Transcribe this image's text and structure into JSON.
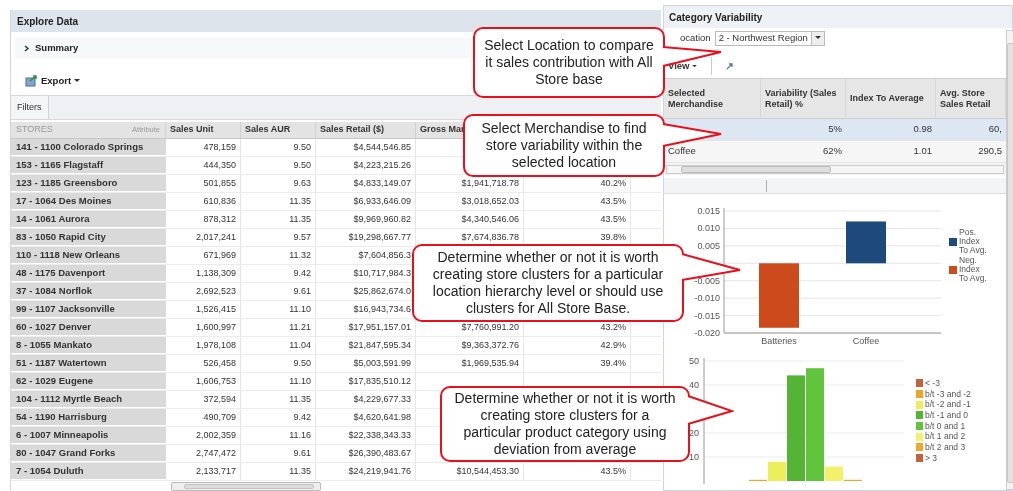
{
  "explore_panel": {
    "title": "Explore Data",
    "summary": {
      "label": "Summary",
      "expanded": false
    },
    "export_label": "Export",
    "filters_tab": "Filters",
    "table": {
      "columns": {
        "store": "STORES",
        "attribute": "Attribute",
        "sales_unit": "Sales Unit",
        "sales_aur": "Sales AUR",
        "sales_retail": "Sales Retail ($)",
        "gross_margin": "Gross Mar"
      },
      "rows": [
        {
          "store": "141 - 1100 Colorado Springs",
          "sales_unit": "478,159",
          "sales_aur": "9.50",
          "sales_retail": "$4,544,546.85"
        },
        {
          "store": "153 - 1165 Flagstaff",
          "sales_unit": "444,350",
          "sales_aur": "9.50",
          "sales_retail": "$4,223,215.26"
        },
        {
          "store": "123 - 1185 Greensboro",
          "sales_unit": "501,855",
          "sales_aur": "9.63",
          "sales_retail": "$4,833,149.07",
          "gross_margin": "$1,941,718.78",
          "column_6": "40.2%"
        },
        {
          "store": "17 - 1064 Des Moines",
          "sales_unit": "610,836",
          "sales_aur": "11.35",
          "sales_retail": "$6,933,646.09",
          "gross_margin": "$3,018,652.03",
          "column_6": "43.5%"
        },
        {
          "store": "14 - 1061 Aurora",
          "sales_unit": "878,312",
          "sales_aur": "11.35",
          "sales_retail": "$9,969,960.82",
          "gross_margin": "$4,340,546.06",
          "column_6": "43.5%"
        },
        {
          "store": "83 - 1050 Rapid City",
          "sales_unit": "2,017,241",
          "sales_aur": "9.57",
          "sales_retail": "$19,298,667.77",
          "gross_margin": "$7,674,836.78",
          "column_6": "39.8%"
        },
        {
          "store": "110 - 1118 New Orleans",
          "sales_unit": "671,969",
          "sales_aur": "11.32",
          "sales_retail": "$7,604,856.3"
        },
        {
          "store": "48 - 1175 Davenport",
          "sales_unit": "1,138,309",
          "sales_aur": "9.42",
          "sales_retail": "$10,717,984.3"
        },
        {
          "store": "37 - 1084 Norflok",
          "sales_unit": "2,692,523",
          "sales_aur": "9.61",
          "sales_retail": "$25,862,674.0"
        },
        {
          "store": "99 - 1107 Jacksonville",
          "sales_unit": "1,526,415",
          "sales_aur": "11.10",
          "sales_retail": "$16,943,734.6"
        },
        {
          "store": "60 - 1027 Denver",
          "sales_unit": "1,600,997",
          "sales_aur": "11.21",
          "sales_retail": "$17,951,157.01",
          "gross_margin": "$7,760,991.20",
          "column_6": "43.2%"
        },
        {
          "store": "8 - 1055 Mankato",
          "sales_unit": "1,978,108",
          "sales_aur": "11.04",
          "sales_retail": "$21,847,595.34",
          "gross_margin": "$9,363,372.76",
          "column_6": "42.9%"
        },
        {
          "store": "51 - 1187 Watertown",
          "sales_unit": "526,458",
          "sales_aur": "9.50",
          "sales_retail": "$5,003,591.99",
          "gross_margin": "$1,969,535.94",
          "column_6": "39.4%"
        },
        {
          "store": "62 - 1029 Eugene",
          "sales_unit": "1,606,753",
          "sales_aur": "11.10",
          "sales_retail": "$17,835,510.12"
        },
        {
          "store": "104 - 1112 Myrtle Beach",
          "sales_unit": "372,594",
          "sales_aur": "11.35",
          "sales_retail": "$4,229,677.33"
        },
        {
          "store": "54 - 1190 Harrisburg",
          "sales_unit": "490,709",
          "sales_aur": "9.42",
          "sales_retail": "$4,620,641.98"
        },
        {
          "store": "6 - 1007 Minneapolis",
          "sales_unit": "2,002,359",
          "sales_aur": "11.16",
          "sales_retail": "$22,338,343.33"
        },
        {
          "store": "80 - 1047 Grand Forks",
          "sales_unit": "2,747,472",
          "sales_aur": "9.61",
          "sales_retail": "$26,390,483.67"
        },
        {
          "store": "7 - 1054 Duluth",
          "sales_unit": "2,133,717",
          "sales_aur": "11.35",
          "sales_retail": "$24,219,941.76",
          "gross_margin": "$10,544,453.30",
          "column_6": "43.5%"
        }
      ]
    }
  },
  "variability_panel": {
    "title": "Category Variability",
    "location_label": "ocation",
    "location_value": "2 - Northwest Region",
    "view_label": "View",
    "table": {
      "columns": [
        "Selected Merchandise",
        "Variability (Sales Retail) %",
        "Index To Average",
        "Avg. Store Sales Retail"
      ],
      "rows": [
        {
          "selected": true,
          "variability": "5%",
          "index": "0.98",
          "avg_store_sales_retail": "60,"
        },
        {
          "selected": false,
          "merchandise": "Coffee",
          "variability": "62%",
          "index": "1.01",
          "avg_store_sales_retail": "290,5"
        }
      ]
    },
    "charts": [
      {
        "chart_data": {
          "type": "bar",
          "grid": true,
          "legend": true,
          "categories": [
            "Batteries",
            "Coffee"
          ],
          "ylim": [
            -0.02,
            0.015
          ],
          "yticks": [
            {
              "value": 0.015,
              "label": "0.015"
            },
            {
              "value": 0.01,
              "label": "0.010"
            },
            {
              "value": 0.005,
              "label": "0.005"
            },
            {
              "value": -0.005,
              "label": "-0.005"
            },
            {
              "value": -0.01,
              "label": "-0.010"
            },
            {
              "value": -0.015,
              "label": "-0.015"
            },
            {
              "value": -0.02,
              "label": "-0.020"
            }
          ],
          "series": [
            {
              "name": "Pos. Index To Avg.",
              "color": "#1d4a7a",
              "values": [
                null,
                0.012
              ]
            },
            {
              "name": "Neg. Index To Avg.",
              "color": "#cc4a1c",
              "values": [
                -0.0185,
                null
              ]
            }
          ]
        }
      },
      {
        "chart_data": {
          "type": "bar",
          "grid": true,
          "legend": true,
          "ylim": [
            0,
            50
          ],
          "yticks": [
            10,
            20,
            40,
            50
          ],
          "series": [
            {
              "name": "< -3",
              "color": "#c4623f",
              "values": [
                0
              ]
            },
            {
              "name": "b/t -3 and -2",
              "color": "#f0a526",
              "values": [
                0.5
              ]
            },
            {
              "name": "b/t -2 and -1",
              "color": "#eeee5a",
              "values": [
                8
              ]
            },
            {
              "name": "b/t -1 and 0",
              "color": "#54b534",
              "values": [
                44
              ]
            },
            {
              "name": "b/t 0 and 1",
              "color": "#62c43c",
              "values": [
                47
              ]
            },
            {
              "name": "b/t 1 and 2",
              "color": "#f2f26a",
              "values": [
                6
              ]
            },
            {
              "name": "b/t 2 and 3",
              "color": "#f0a830",
              "values": [
                0.5
              ]
            },
            {
              "name": "> 3",
              "color": "#c4623f",
              "values": [
                0
              ]
            }
          ]
        }
      }
    ]
  },
  "callouts": [
    {
      "text": "Select Location to compare it sales contribution with All Store base"
    },
    {
      "text": "Select Merchandise to  find store variability within the selected location"
    },
    {
      "text": "Determine whether or not it is worth creating store clusters for a particular location  hierarchy level or should use clusters for All Store Base."
    },
    {
      "text": "Determine whether or not it is worth creating store clusters for a particular product category using deviation from average"
    }
  ]
}
